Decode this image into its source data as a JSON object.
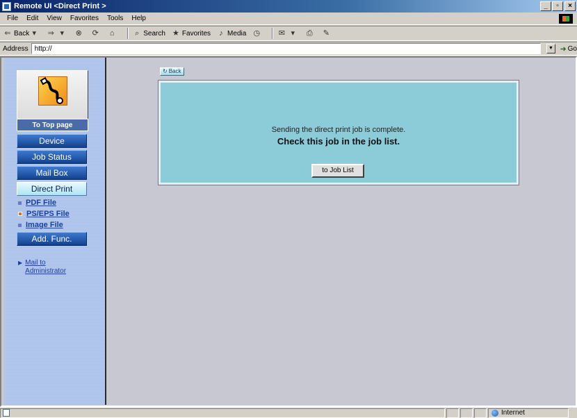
{
  "window": {
    "title": "Remote UI <Direct Print >",
    "controls": [
      "_",
      "▫",
      "×"
    ]
  },
  "menu": [
    "File",
    "Edit",
    "View",
    "Favorites",
    "Tools",
    "Help"
  ],
  "toolbar": {
    "back": "Back",
    "search": "Search",
    "favorites": "Favorites",
    "media": "Media"
  },
  "address": {
    "label": "Address",
    "value": "http://",
    "go": "Go"
  },
  "sidebar": {
    "home_label": "To Top page",
    "nav": [
      "Device",
      "Job Status",
      "Mail Box",
      "Direct Print",
      "Add. Func."
    ],
    "active": "Direct Print",
    "sub_items": [
      "PDF File",
      "PS/EPS File",
      "Image File"
    ],
    "mail_admin": "Mail to Administrator"
  },
  "main": {
    "back": "Back",
    "message_line1": "Sending the direct print job is complete.",
    "message_line2": "Check this job in the job list.",
    "job_list_button": "to Job List"
  },
  "status": {
    "zone": "Internet"
  },
  "colors": {
    "panel": "#8cccd8",
    "nav_button": "#1e5bb0",
    "active_nav": "#c6ecf6",
    "link": "#1a3fa0"
  }
}
